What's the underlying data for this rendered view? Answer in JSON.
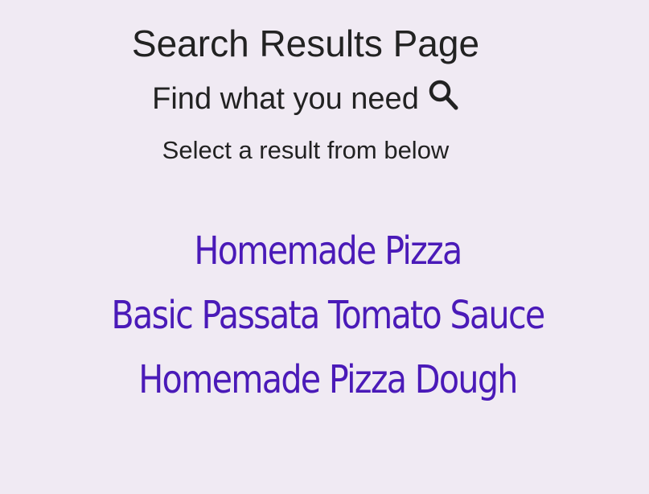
{
  "header": {
    "title": "Search Results Page",
    "subtitle": "Find what you need",
    "subtitle_icon": "search-icon",
    "instructions": "Select a result from below"
  },
  "results": [
    {
      "label": "Homemade Pizza"
    },
    {
      "label": "Basic Passata Tomato Sauce"
    },
    {
      "label": "Homemade Pizza Dough"
    }
  ],
  "colors": {
    "background": "#f0eaf3",
    "text": "#222222",
    "link": "#4a1ab8"
  }
}
